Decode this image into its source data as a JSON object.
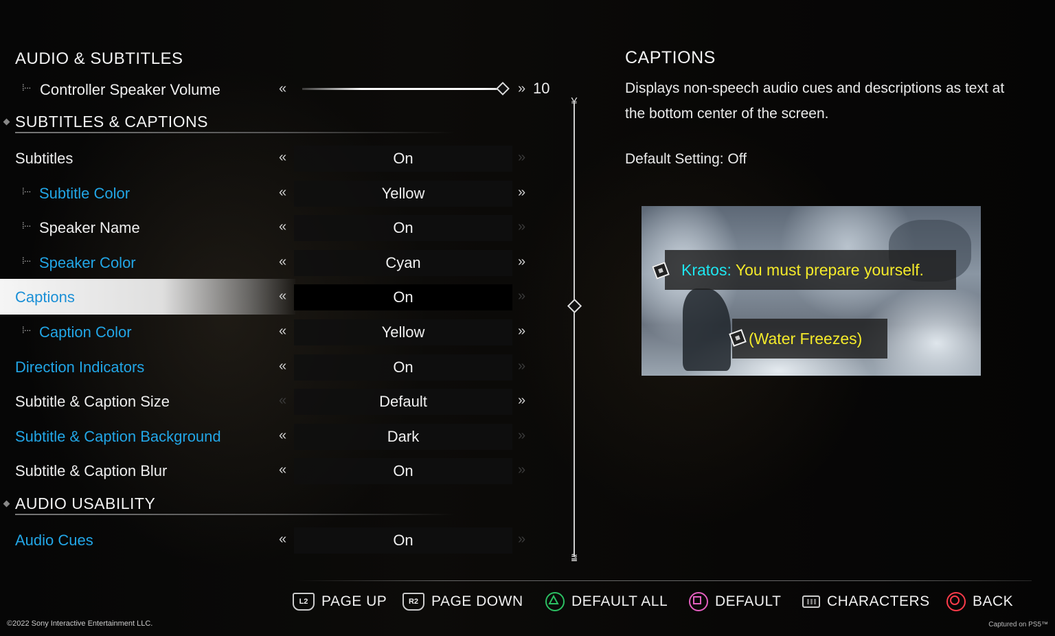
{
  "left_panel": {
    "section_audio": "AUDIO & SUBTITLES",
    "controller_speaker_volume": {
      "label": "Controller Speaker Volume",
      "value": "10",
      "level": 1.0
    },
    "section_subtitles": "SUBTITLES & CAPTIONS",
    "rows": [
      {
        "label": "Subtitles",
        "value": "On",
        "color": "white",
        "indent": false
      },
      {
        "label": "Subtitle Color",
        "value": "Yellow",
        "color": "blue",
        "indent": true
      },
      {
        "label": "Speaker Name",
        "value": "On",
        "color": "white",
        "indent": true
      },
      {
        "label": "Speaker Color",
        "value": "Cyan",
        "color": "blue",
        "indent": true
      },
      {
        "label": "Captions",
        "value": "On",
        "color": "blue",
        "indent": false,
        "selected": true
      },
      {
        "label": "Caption Color",
        "value": "Yellow",
        "color": "blue",
        "indent": true
      },
      {
        "label": "Direction Indicators",
        "value": "On",
        "color": "blue",
        "indent": false
      },
      {
        "label": "Subtitle & Caption Size",
        "value": "Default",
        "color": "white",
        "indent": false
      },
      {
        "label": "Subtitle & Caption Background",
        "value": "Dark",
        "color": "blue",
        "indent": false
      },
      {
        "label": "Subtitle & Caption Blur",
        "value": "On",
        "color": "white",
        "indent": false
      }
    ],
    "section_audio_usability": "AUDIO USABILITY",
    "audio_cues": {
      "label": "Audio Cues",
      "value": "On"
    }
  },
  "right_panel": {
    "title": "CAPTIONS",
    "description": "Displays non-speech audio cues and descriptions as text at the bottom center of the screen.",
    "default_setting": "Default Setting: Off",
    "preview": {
      "speaker": "Kratos:",
      "line": "You must prepare yourself.",
      "caption": "(Water Freezes)"
    }
  },
  "button_bar": {
    "page_up": {
      "glyph": "L2",
      "label": "PAGE UP"
    },
    "page_down": {
      "glyph": "R2",
      "label": "PAGE DOWN"
    },
    "default_all": {
      "label": "DEFAULT ALL"
    },
    "default": {
      "label": "DEFAULT"
    },
    "characters": {
      "label": "CHARACTERS"
    },
    "back": {
      "label": "BACK"
    }
  },
  "footer": {
    "copyright": "©2022 Sony Interactive Entertainment LLC.",
    "captured": "Captured on PS5™"
  },
  "colors": {
    "accent_blue": "#22a6e6",
    "caption_cyan": "#1ee6f0",
    "caption_yellow": "#f4ea2a",
    "triangle_green": "#2bbf62",
    "square_pink": "#e35fbf",
    "circle_red": "#ff3b4a"
  },
  "icons": {
    "tree_branch": "tree-branch-icon",
    "arrow_left": "double-chevron-left-icon",
    "arrow_right": "double-chevron-right-icon",
    "triangle": "triangle-button-icon",
    "square": "square-button-icon",
    "circle": "circle-button-icon",
    "keyboard": "keyboard-icon"
  }
}
